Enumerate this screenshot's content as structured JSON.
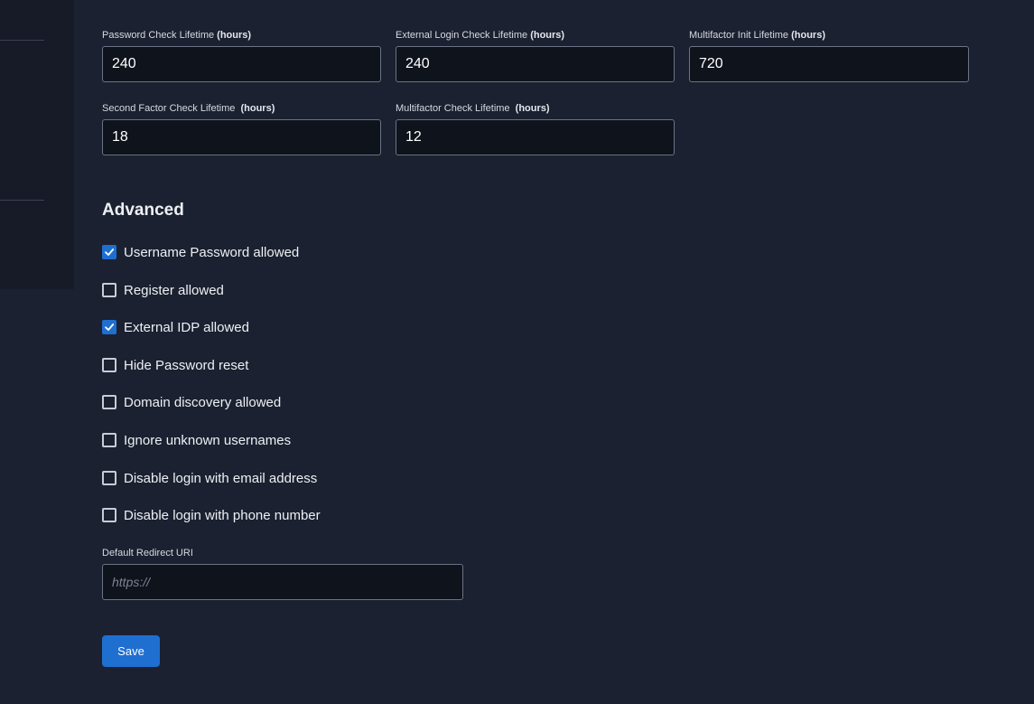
{
  "lifetimes": {
    "password_check": {
      "label": "Password Check Lifetime",
      "unit": "(hours)",
      "value": "240"
    },
    "external_login_check": {
      "label": "External Login Check Lifetime",
      "unit": "(hours)",
      "value": "240"
    },
    "multifactor_init": {
      "label": "Multifactor Init Lifetime",
      "unit": "(hours)",
      "value": "720"
    },
    "second_factor_check": {
      "label": "Second Factor Check Lifetime",
      "unit": "(hours)",
      "value": "18"
    },
    "multifactor_check": {
      "label": "Multifactor Check Lifetime",
      "unit": "(hours)",
      "value": "12"
    }
  },
  "advanced": {
    "title": "Advanced",
    "options": [
      {
        "label": "Username Password allowed",
        "checked": true
      },
      {
        "label": "Register allowed",
        "checked": false
      },
      {
        "label": "External IDP allowed",
        "checked": true
      },
      {
        "label": "Hide Password reset",
        "checked": false
      },
      {
        "label": "Domain discovery allowed",
        "checked": false
      },
      {
        "label": "Ignore unknown usernames",
        "checked": false
      },
      {
        "label": "Disable login with email address",
        "checked": false
      },
      {
        "label": "Disable login with phone number",
        "checked": false
      }
    ]
  },
  "redirect": {
    "label": "Default Redirect URI",
    "placeholder": "https://",
    "value": ""
  },
  "actions": {
    "save_label": "Save"
  },
  "colors": {
    "accent": "#1f6fd1",
    "background": "#1b2130",
    "input_bg": "#0f131c"
  }
}
